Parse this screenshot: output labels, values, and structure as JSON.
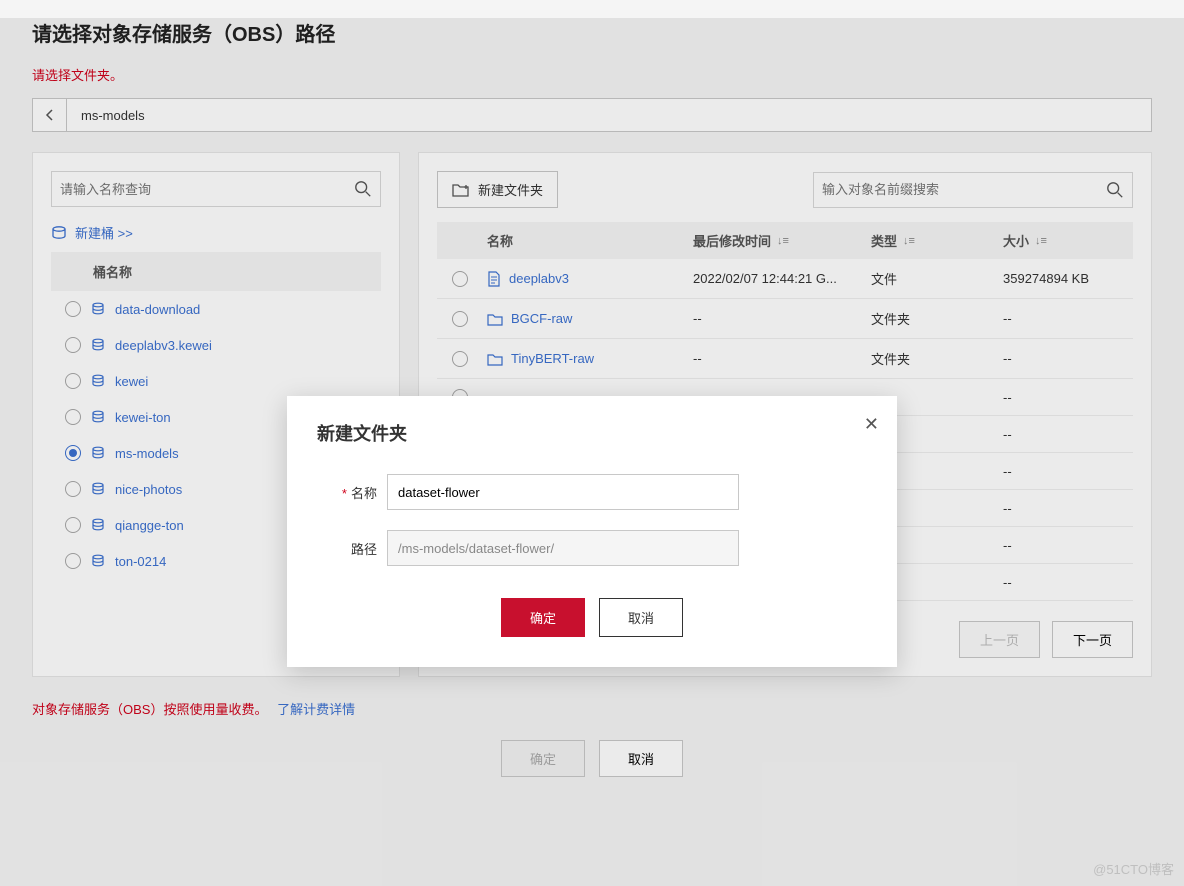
{
  "header": {
    "title": "请选择对象存储服务（OBS）路径",
    "warning": "请选择文件夹。"
  },
  "breadcrumb": {
    "path": "ms-models"
  },
  "sidebar": {
    "search_placeholder": "请输入名称查询",
    "new_bucket_label": "新建桶 >>",
    "bucket_header": "桶名称",
    "buckets": [
      {
        "name": "data-download",
        "selected": false
      },
      {
        "name": "deeplabv3.kewei",
        "selected": false
      },
      {
        "name": "kewei",
        "selected": false
      },
      {
        "name": "kewei-ton",
        "selected": false
      },
      {
        "name": "ms-models",
        "selected": true
      },
      {
        "name": "nice-photos",
        "selected": false
      },
      {
        "name": "qiangge-ton",
        "selected": false
      },
      {
        "name": "ton-0214",
        "selected": false
      }
    ]
  },
  "main": {
    "new_folder_btn": "新建文件夹",
    "search_placeholder": "输入对象名前缀搜索",
    "columns": {
      "name": "名称",
      "modified": "最后修改时间",
      "type": "类型",
      "size": "大小"
    },
    "rows": [
      {
        "icon": "file",
        "name": "deeplabv3",
        "modified": "2022/02/07 12:44:21 G...",
        "type": "文件",
        "size": "359274894 KB"
      },
      {
        "icon": "folder",
        "name": "BGCF-raw",
        "modified": "--",
        "type": "文件夹",
        "size": "--"
      },
      {
        "icon": "folder",
        "name": "TinyBERT-raw",
        "modified": "--",
        "type": "文件夹",
        "size": "--"
      },
      {
        "icon": "",
        "name": "",
        "modified": "",
        "type": "",
        "size": "--"
      },
      {
        "icon": "",
        "name": "",
        "modified": "",
        "type": "",
        "size": "--"
      },
      {
        "icon": "",
        "name": "",
        "modified": "",
        "type": "",
        "size": "--"
      },
      {
        "icon": "",
        "name": "",
        "modified": "",
        "type": "",
        "size": "--"
      },
      {
        "icon": "",
        "name": "",
        "modified": "",
        "type": "",
        "size": "--"
      },
      {
        "icon": "",
        "name": "",
        "modified": "",
        "type": "",
        "size": "--"
      }
    ],
    "pager": {
      "prev": "上一页",
      "next": "下一页"
    }
  },
  "footer": {
    "note": "对象存储服务（OBS）按照使用量收费。",
    "link": "了解计费详情"
  },
  "page_actions": {
    "confirm": "确定",
    "cancel": "取消"
  },
  "modal": {
    "title": "新建文件夹",
    "name_label": "名称",
    "name_value": "dataset-flower",
    "path_label": "路径",
    "path_value": "/ms-models/dataset-flower/",
    "confirm": "确定",
    "cancel": "取消"
  },
  "watermark": "@51CTO博客"
}
